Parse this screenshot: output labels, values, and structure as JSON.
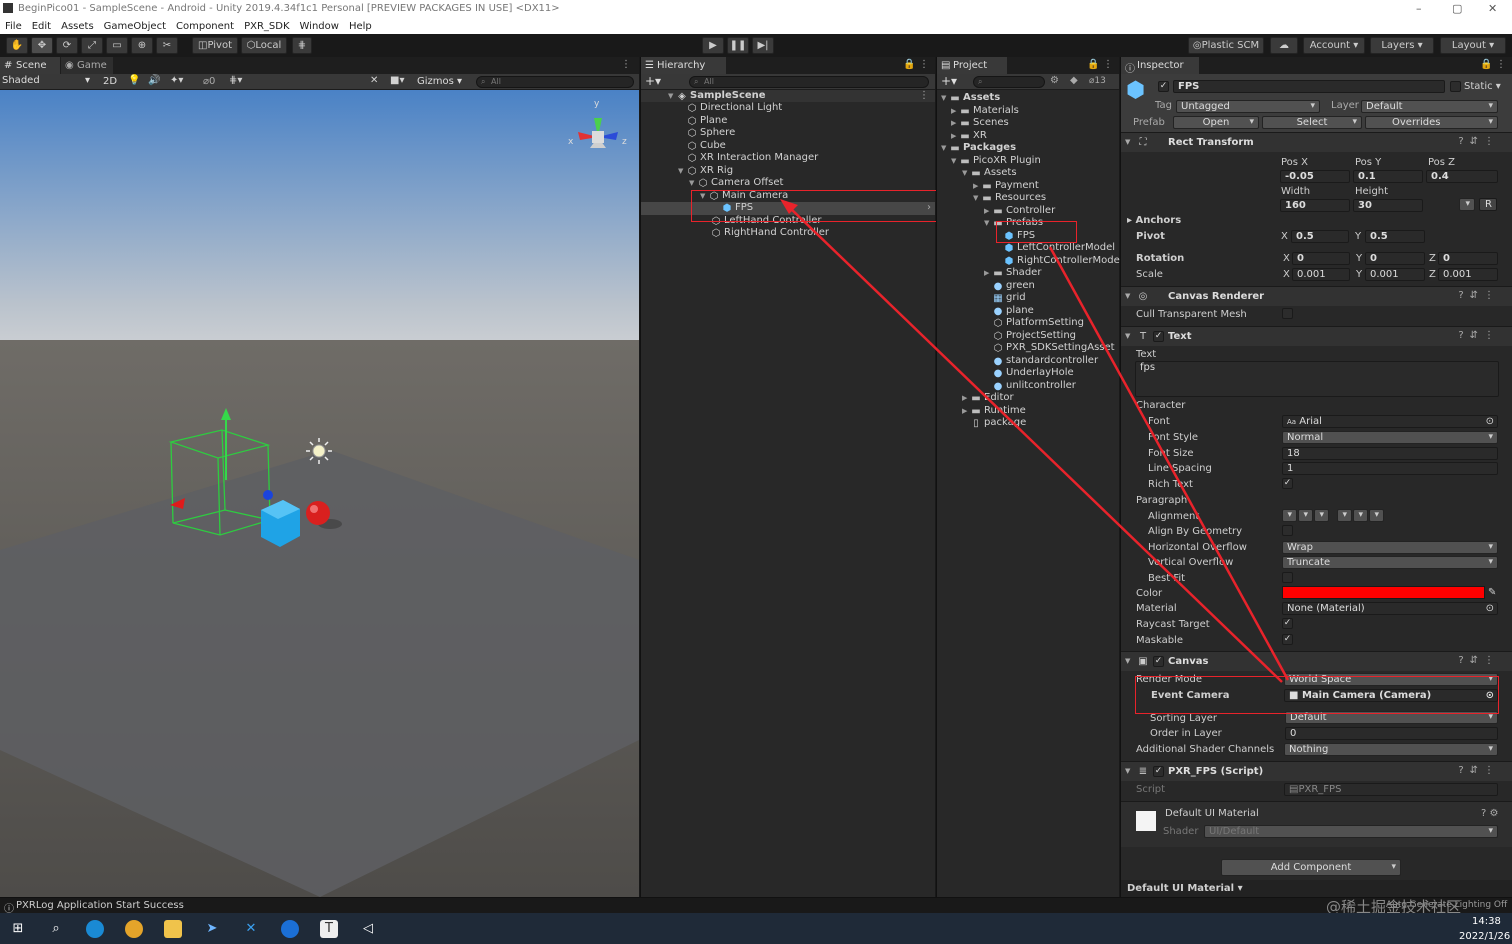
{
  "window": {
    "title": "BeginPico01 - SampleScene - Android - Unity 2019.4.34f1c1 Personal [PREVIEW PACKAGES IN USE] <DX11>",
    "minimize": "–",
    "maximize": "▢",
    "close": "✕"
  },
  "menu": [
    "File",
    "Edit",
    "Assets",
    "GameObject",
    "Component",
    "PXR_SDK",
    "Window",
    "Help"
  ],
  "toolbar": {
    "pivot": "Pivot",
    "local": "Local",
    "plastic": "Plastic SCM",
    "account": "Account",
    "layers": "Layers",
    "layout": "Layout"
  },
  "scene": {
    "tab_scene": "Scene",
    "tab_game": "Game",
    "shading": "Shaded",
    "mode_2d": "2D",
    "hidden_count": "0",
    "gizmos": "Gizmos",
    "search_placeholder": "All",
    "axis_y": "y",
    "axis_x": "x",
    "axis_z": "z"
  },
  "hierarchy": {
    "tab": "Hierarchy",
    "search_placeholder": "All",
    "scene_name": "SampleScene",
    "items": [
      {
        "label": "Directional Light"
      },
      {
        "label": "Plane"
      },
      {
        "label": "Sphere"
      },
      {
        "label": "Cube"
      },
      {
        "label": "XR Interaction Manager"
      },
      {
        "label": "XR Rig"
      },
      {
        "label": "Camera Offset"
      },
      {
        "label": "Main Camera"
      },
      {
        "label": "FPS"
      },
      {
        "label": "LeftHand Controller"
      },
      {
        "label": "RightHand Controller"
      }
    ]
  },
  "project": {
    "tab": "Project",
    "hidden_count": "13",
    "items": [
      {
        "label": "Assets"
      },
      {
        "label": "Materials"
      },
      {
        "label": "Scenes"
      },
      {
        "label": "XR"
      },
      {
        "label": "Packages"
      },
      {
        "label": "PicoXR Plugin"
      },
      {
        "label": "Assets"
      },
      {
        "label": "Payment"
      },
      {
        "label": "Resources"
      },
      {
        "label": "Controller"
      },
      {
        "label": "Prefabs"
      },
      {
        "label": "FPS"
      },
      {
        "label": "LeftControllerModel"
      },
      {
        "label": "RightControllerModel"
      },
      {
        "label": "Shader"
      },
      {
        "label": "green"
      },
      {
        "label": "grid"
      },
      {
        "label": "plane"
      },
      {
        "label": "PlatformSetting"
      },
      {
        "label": "ProjectSetting"
      },
      {
        "label": "PXR_SDKSettingAsset"
      },
      {
        "label": "standardcontroller"
      },
      {
        "label": "UnderlayHole"
      },
      {
        "label": "unlitcontroller"
      },
      {
        "label": "Editor"
      },
      {
        "label": "Runtime"
      },
      {
        "label": "package"
      }
    ]
  },
  "inspector": {
    "tab": "Inspector",
    "object_name": "FPS",
    "static_label": "Static",
    "tag_label": "Tag",
    "tag_value": "Untagged",
    "layer_label": "Layer",
    "layer_value": "Default",
    "prefab_label": "Prefab",
    "prefab_open": "Open",
    "prefab_select": "Select",
    "prefab_overrides": "Overrides",
    "rect_transform": {
      "title": "Rect Transform",
      "posx_label": "Pos X",
      "posy_label": "Pos Y",
      "posz_label": "Pos Z",
      "posx": "-0.05",
      "posy": "0.1",
      "posz": "0.4",
      "width_label": "Width",
      "height_label": "Height",
      "width": "160",
      "height": "30",
      "r_button": "R",
      "anchors": "Anchors",
      "pivot": "Pivot",
      "pivot_x_label": "X",
      "pivot_x": "0.5",
      "pivot_y_label": "Y",
      "pivot_y": "0.5",
      "rotation": "Rotation",
      "rot_x": "0",
      "rot_y": "0",
      "rot_z": "0",
      "scale": "Scale",
      "scale_x": "0.001",
      "scale_y": "0.001",
      "scale_z": "0.001",
      "x_label": "X",
      "y_label": "Y",
      "z_label": "Z"
    },
    "canvas_renderer": {
      "title": "Canvas Renderer",
      "cull_label": "Cull Transparent Mesh"
    },
    "text": {
      "title": "Text",
      "text_label": "Text",
      "text_value": "fps",
      "character": "Character",
      "font_label": "Font",
      "font_value": "Arial",
      "font_prefix": "Aa",
      "font_style_label": "Font Style",
      "font_style_value": "Normal",
      "font_size_label": "Font Size",
      "font_size_value": "18",
      "line_spacing_label": "Line Spacing",
      "line_spacing_value": "1",
      "rich_text_label": "Rich Text",
      "paragraph": "Paragraph",
      "alignment_label": "Alignment",
      "align_geometry_label": "Align By Geometry",
      "h_overflow_label": "Horizontal Overflow",
      "h_overflow_value": "Wrap",
      "v_overflow_label": "Vertical Overflow",
      "v_overflow_value": "Truncate",
      "best_fit_label": "Best Fit",
      "color_label": "Color",
      "color_value": "#ff0000",
      "material_label": "Material",
      "material_value": "None (Material)",
      "raycast_label": "Raycast Target",
      "maskable_label": "Maskable"
    },
    "canvas": {
      "title": "Canvas",
      "render_mode_label": "Render Mode",
      "render_mode_value": "World Space",
      "event_camera_label": "Event Camera",
      "event_camera_value": "Main Camera (Camera)",
      "sorting_layer_label": "Sorting Layer",
      "sorting_layer_value": "Default",
      "order_label": "Order in Layer",
      "order_value": "0",
      "shader_channels_label": "Additional Shader Channels",
      "shader_channels_value": "Nothing"
    },
    "script": {
      "title": "PXR_FPS (Script)",
      "script_label": "Script",
      "script_value": "PXR_FPS"
    },
    "material": {
      "title": "Default UI Material",
      "shader_label": "Shader",
      "shader_value": "UI/Default"
    },
    "add_component": "Add Component",
    "footer": "Default UI Material"
  },
  "status": {
    "message": "PXRLog Application Start Success",
    "right_text": "Auto Generate Lighting Off",
    "watermark": "@稀土掘金技术社区"
  },
  "taskbar": {
    "time": "14:38",
    "date": "2022/1/26",
    "start_icon": "⊞",
    "search_icon": "⌕",
    "unity_letter": "T"
  },
  "colors": {
    "accent_red": "#e8232b",
    "text_color_swatch": "#ff0000",
    "selection": "#474747",
    "panel": "#282828"
  }
}
